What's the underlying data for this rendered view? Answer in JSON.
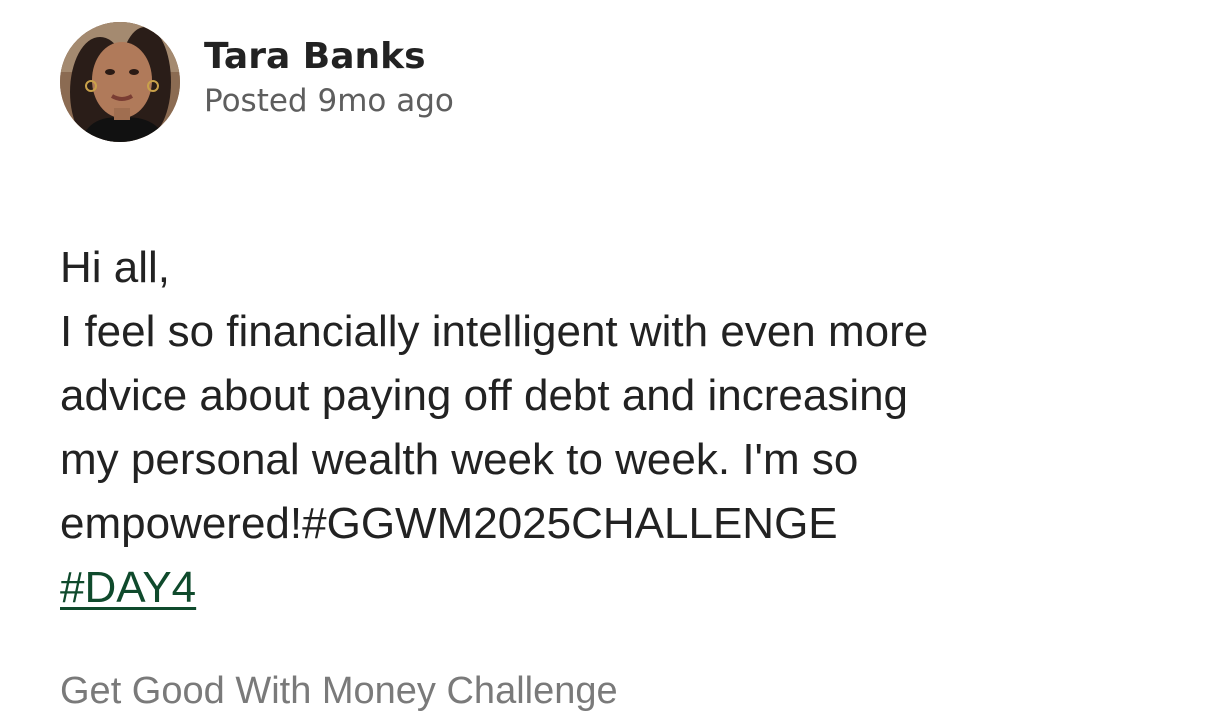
{
  "post": {
    "author": {
      "name": "Tara Banks",
      "posted": "Posted 9mo ago"
    },
    "body": {
      "lines": [
        "Hi all,",
        "I feel so financially intelligent with even more",
        "advice about paying off debt and increasing",
        "my personal wealth week to week. I'm so",
        "empowered!#GGWM2025CHALLENGE"
      ],
      "hashtag": "#DAY4"
    },
    "group": "Get Good With Money Challenge"
  },
  "colors": {
    "hashtag_link": "#0f4a2c",
    "secondary_text": "#7a7a7a",
    "primary_text": "#222222"
  }
}
